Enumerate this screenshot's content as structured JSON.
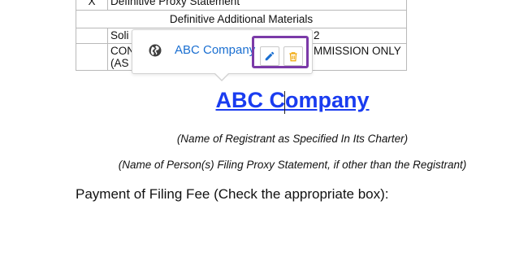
{
  "table": {
    "rows": [
      {
        "mark": "X",
        "text": "Definitive Proxy Statement"
      },
      {
        "mark": "",
        "text": "Definitive Additional Materials"
      },
      {
        "mark": "",
        "text": "Soli",
        "tail": "2"
      },
      {
        "mark": "",
        "text": "CON",
        "text2": "(AS",
        "tail": "MMISSION ONLY"
      }
    ]
  },
  "popup": {
    "globe_icon": "globe-icon",
    "link_text": "ABC Company",
    "edit_icon": "pencil-icon",
    "delete_icon": "trash-icon",
    "highlight_color": "#7b3aa8",
    "edit_color": "#1a6fd1",
    "delete_color": "#f0a500"
  },
  "document": {
    "company_name": "ABC Company",
    "caption_registrant": "(Name of Registrant as Specified In Its Charter)",
    "caption_filer": "(Name of Person(s) Filing Proxy Statement, if other than the Registrant)",
    "payment_text": "Payment of Filing Fee (Check the appropriate box):",
    "link_color": "#1a3cf0"
  }
}
